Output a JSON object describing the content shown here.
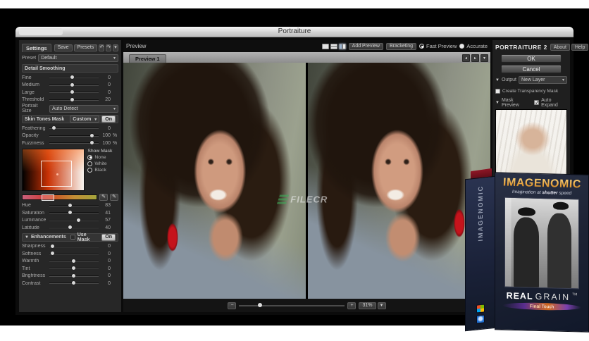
{
  "window": {
    "title": "Portraiture"
  },
  "icons": {
    "undo": "↶",
    "redo": "↷",
    "chevron_down": "▾",
    "triangle_down": "▼",
    "prev": "◂",
    "next": "▸",
    "minus": "−",
    "plus": "+",
    "eyedropper_add": "✛",
    "eyedropper": "✎"
  },
  "settings_panel": {
    "tab": "Settings",
    "save": "Save",
    "presets": "Presets",
    "preset_label": "Preset",
    "preset_value": "Default",
    "detail_smoothing": {
      "title": "Detail Smoothing",
      "sliders": [
        {
          "label": "Fine",
          "value": "0",
          "pos": 45
        },
        {
          "label": "Medium",
          "value": "0",
          "pos": 45
        },
        {
          "label": "Large",
          "value": "0",
          "pos": 45
        },
        {
          "label": "Threshold",
          "value": "20",
          "pos": 45
        }
      ],
      "portrait_size_label": "Portrait Size",
      "portrait_size_value": "Auto Detect"
    },
    "skin_tones_mask": {
      "title": "Skin Tones Mask",
      "mode": "Custom",
      "on": "On",
      "sliders": [
        {
          "label": "Feathering",
          "value": "0",
          "pos": 8
        },
        {
          "label": "Opacity",
          "value": "100",
          "unit": "%",
          "pos": 86
        },
        {
          "label": "Fuzziness",
          "value": "100",
          "unit": "%",
          "pos": 86
        }
      ],
      "show_mask": {
        "title": "Show Mask",
        "options": [
          "None",
          "White",
          "Black"
        ],
        "selected": "None"
      },
      "tone_sliders": [
        {
          "label": "Hue",
          "value": "83",
          "pos": 42
        },
        {
          "label": "Saturation",
          "value": "41",
          "pos": 42
        },
        {
          "label": "Luminance",
          "value": "57",
          "pos": 58
        },
        {
          "label": "Latitude",
          "value": "40",
          "pos": 42
        }
      ]
    },
    "enhancements": {
      "title": "Enhancements",
      "use_mask": "Use Mask",
      "on": "On",
      "sliders": [
        {
          "label": "Sharpness",
          "value": "0",
          "pos": 6
        },
        {
          "label": "Softness",
          "value": "0",
          "pos": 6
        },
        {
          "label": "Warmth",
          "value": "0",
          "pos": 48
        },
        {
          "label": "Tint",
          "value": "0",
          "pos": 48
        },
        {
          "label": "Brightness",
          "value": "0",
          "pos": 48
        },
        {
          "label": "Contrast",
          "value": "0",
          "pos": 48
        }
      ]
    }
  },
  "preview": {
    "title": "Preview",
    "add_preview": "Add Preview",
    "bracketing": "Bracketing",
    "fast_preview": "Fast Preview",
    "accurate": "Accurate",
    "tab": "Preview 1",
    "zoom": "31%"
  },
  "action_panel": {
    "brand": "Portraiture",
    "version": "2",
    "about": "About",
    "help": "Help",
    "ok": "OK",
    "cancel": "Cancel",
    "output_label": "Output",
    "output_value": "New Layer",
    "transparency": "Create Transparency Mask",
    "mask_preview": "Mask Preview",
    "auto_expand": "Auto Expand"
  },
  "watermark": {
    "text": "FILECR"
  },
  "product_box": {
    "brand": "IMAGENOMIC",
    "tagline_pre": "Imagination at ",
    "tagline_bold": "shutter",
    "tagline_post": " speed",
    "product_word1": "Real",
    "product_word2": "Grain",
    "tm": "TM",
    "subtitle_bold": "Final",
    "subtitle_rest": " Touch",
    "spine_text": "IMAGENOMIC"
  },
  "colors": {
    "accent_gold": "#e8a33d",
    "box_navy": "#1d2334",
    "watermark_green": "#3fae5a",
    "earring_red": "#c5141c",
    "mask_on_button": "#d9d9d9"
  }
}
